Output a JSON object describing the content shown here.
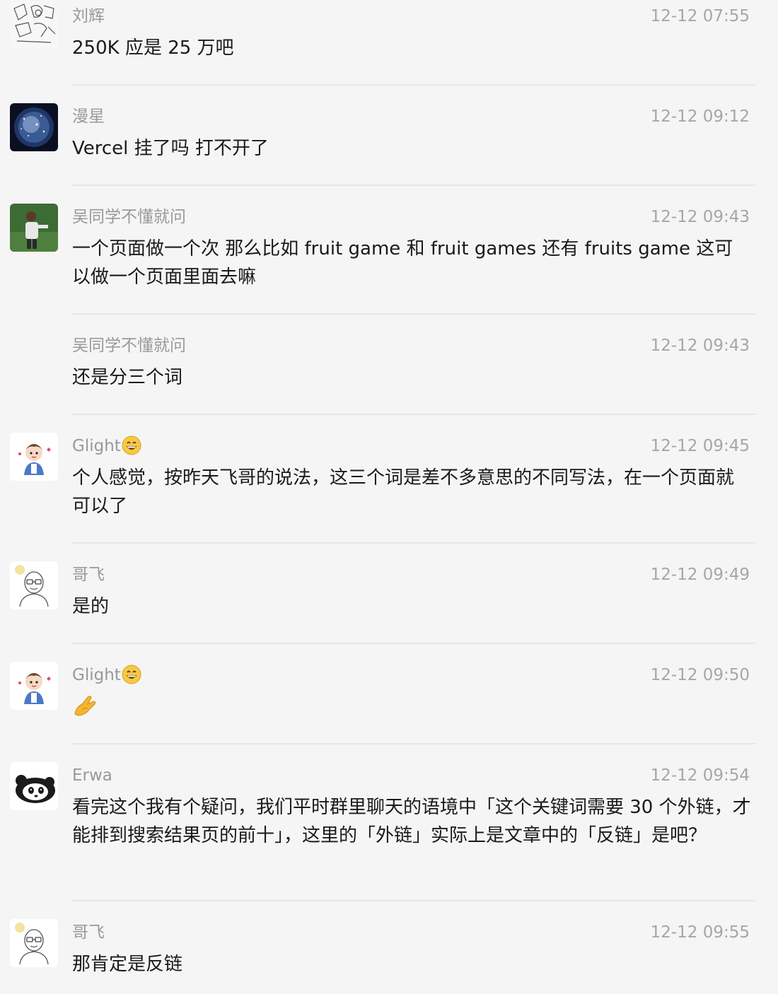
{
  "messages": [
    {
      "name": "刘辉",
      "time": "12-12 07:55",
      "text": "250K 应是 25 万吧",
      "avatar": "sketch-avatar-icon"
    },
    {
      "name": "漫星",
      "time": "12-12 09:12",
      "text": "Vercel 挂了吗  打不开了",
      "avatar": "galaxy-avatar-icon"
    },
    {
      "name": "吴同学不懂就问",
      "time": "12-12 09:43",
      "text": "一个页面做一个次  那么比如 fruit game  和 fruit games  还有 fruits game  这可以做一个页面里面去嘛",
      "avatar": "photo-avatar-icon"
    },
    {
      "name": "吴同学不懂就问",
      "time": "12-12 09:43",
      "text": "还是分三个词",
      "avatar": ""
    },
    {
      "name": "Glight",
      "time": "12-12 09:45",
      "text": "个人感觉，按昨天飞哥的说法，这三个词是差不多意思的不同写法，在一个页面就可以了",
      "avatar": "cartoon-boy-avatar-icon",
      "name_emoji": "grinning-face-icon"
    },
    {
      "name": "哥飞",
      "time": "12-12 09:49",
      "text": "是的",
      "avatar": "glasses-man-avatar-icon"
    },
    {
      "name": "Glight",
      "time": "12-12 09:50",
      "text": "",
      "avatar": "cartoon-boy-avatar-icon",
      "name_emoji": "grinning-face-icon",
      "text_emoji": "pinched-hand-icon"
    },
    {
      "name": "Erwa",
      "time": "12-12 09:54",
      "text": "看完这个我有个疑问，我们平时群里聊天的语境中「这个关键词需要 30 个外链，才能排到搜索结果页的前十」，这里的「外链」实际上是文章中的「反链」是吧？",
      "avatar": "panda-avatar-icon"
    },
    {
      "name": "哥飞",
      "time": "12-12 09:55",
      "text": "那肯定是反链",
      "avatar": "glasses-man-avatar-icon"
    }
  ]
}
